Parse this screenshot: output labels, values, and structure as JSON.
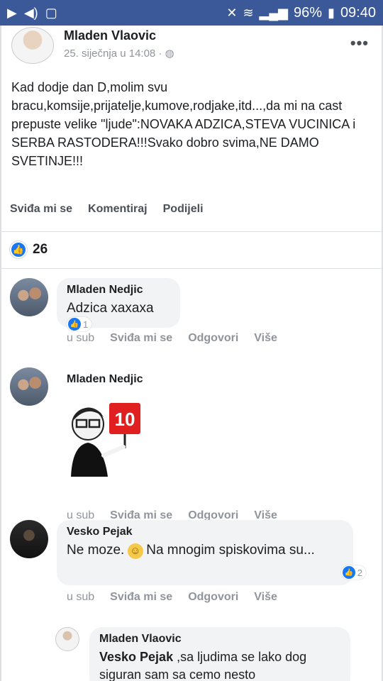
{
  "status_bar": {
    "battery": "96%",
    "time": "09:40",
    "icons": [
      "play-icon",
      "volume-icon",
      "gallery-icon",
      "mute-icon",
      "wifi-icon",
      "signal-icon",
      "battery-icon"
    ]
  },
  "post": {
    "author": "Mladen Vlaovic",
    "timestamp": "25. siječnja u 14:08 · ",
    "more_icon": "more-icon",
    "text": "Kad dodje dan D,molim svu bracu,komsije,prijatelje,kumove,rodjake,itd...,da mi na cast prepuste velike \"ljude\":NOVAKA ADZICA,STEVA VUCINICA i SERBA RASTODERA!!!Svako dobro svima,NE DAMO SVETINJE!!!",
    "actions": {
      "like": "Sviđa mi se",
      "comment": "Komentiraj",
      "share": "Podijeli"
    },
    "reaction_count": "26"
  },
  "comments": [
    {
      "author": "Mladen Nedjic",
      "text": "Adzica xaxaxa",
      "likes": "1",
      "time": "u sub",
      "like": "Sviđa mi se",
      "reply": "Odgovori",
      "more": "Više"
    },
    {
      "author": "Mladen Nedjic",
      "sticker_text": "10",
      "time": "u sub",
      "like": "Sviđa mi se",
      "reply": "Odgovori",
      "more": "Više"
    },
    {
      "author": "Vesko Pejak",
      "text_a": "Ne moze.",
      "text_b": "Na mnogim spiskovima su...",
      "likes": "2",
      "time": "u sub",
      "like": "Sviđa mi se",
      "reply": "Odgovori",
      "more": "Više"
    },
    {
      "author": "Mladen Vlaovic",
      "mention": "Vesko Pejak",
      "text": " ,sa ljudima se lako dog siguran sam sa cemo nesto"
    }
  ],
  "colors": {
    "brand": "#3b5998",
    "like_blue": "#1877f2",
    "bubble": "#f2f3f5",
    "muted": "#90949c"
  }
}
